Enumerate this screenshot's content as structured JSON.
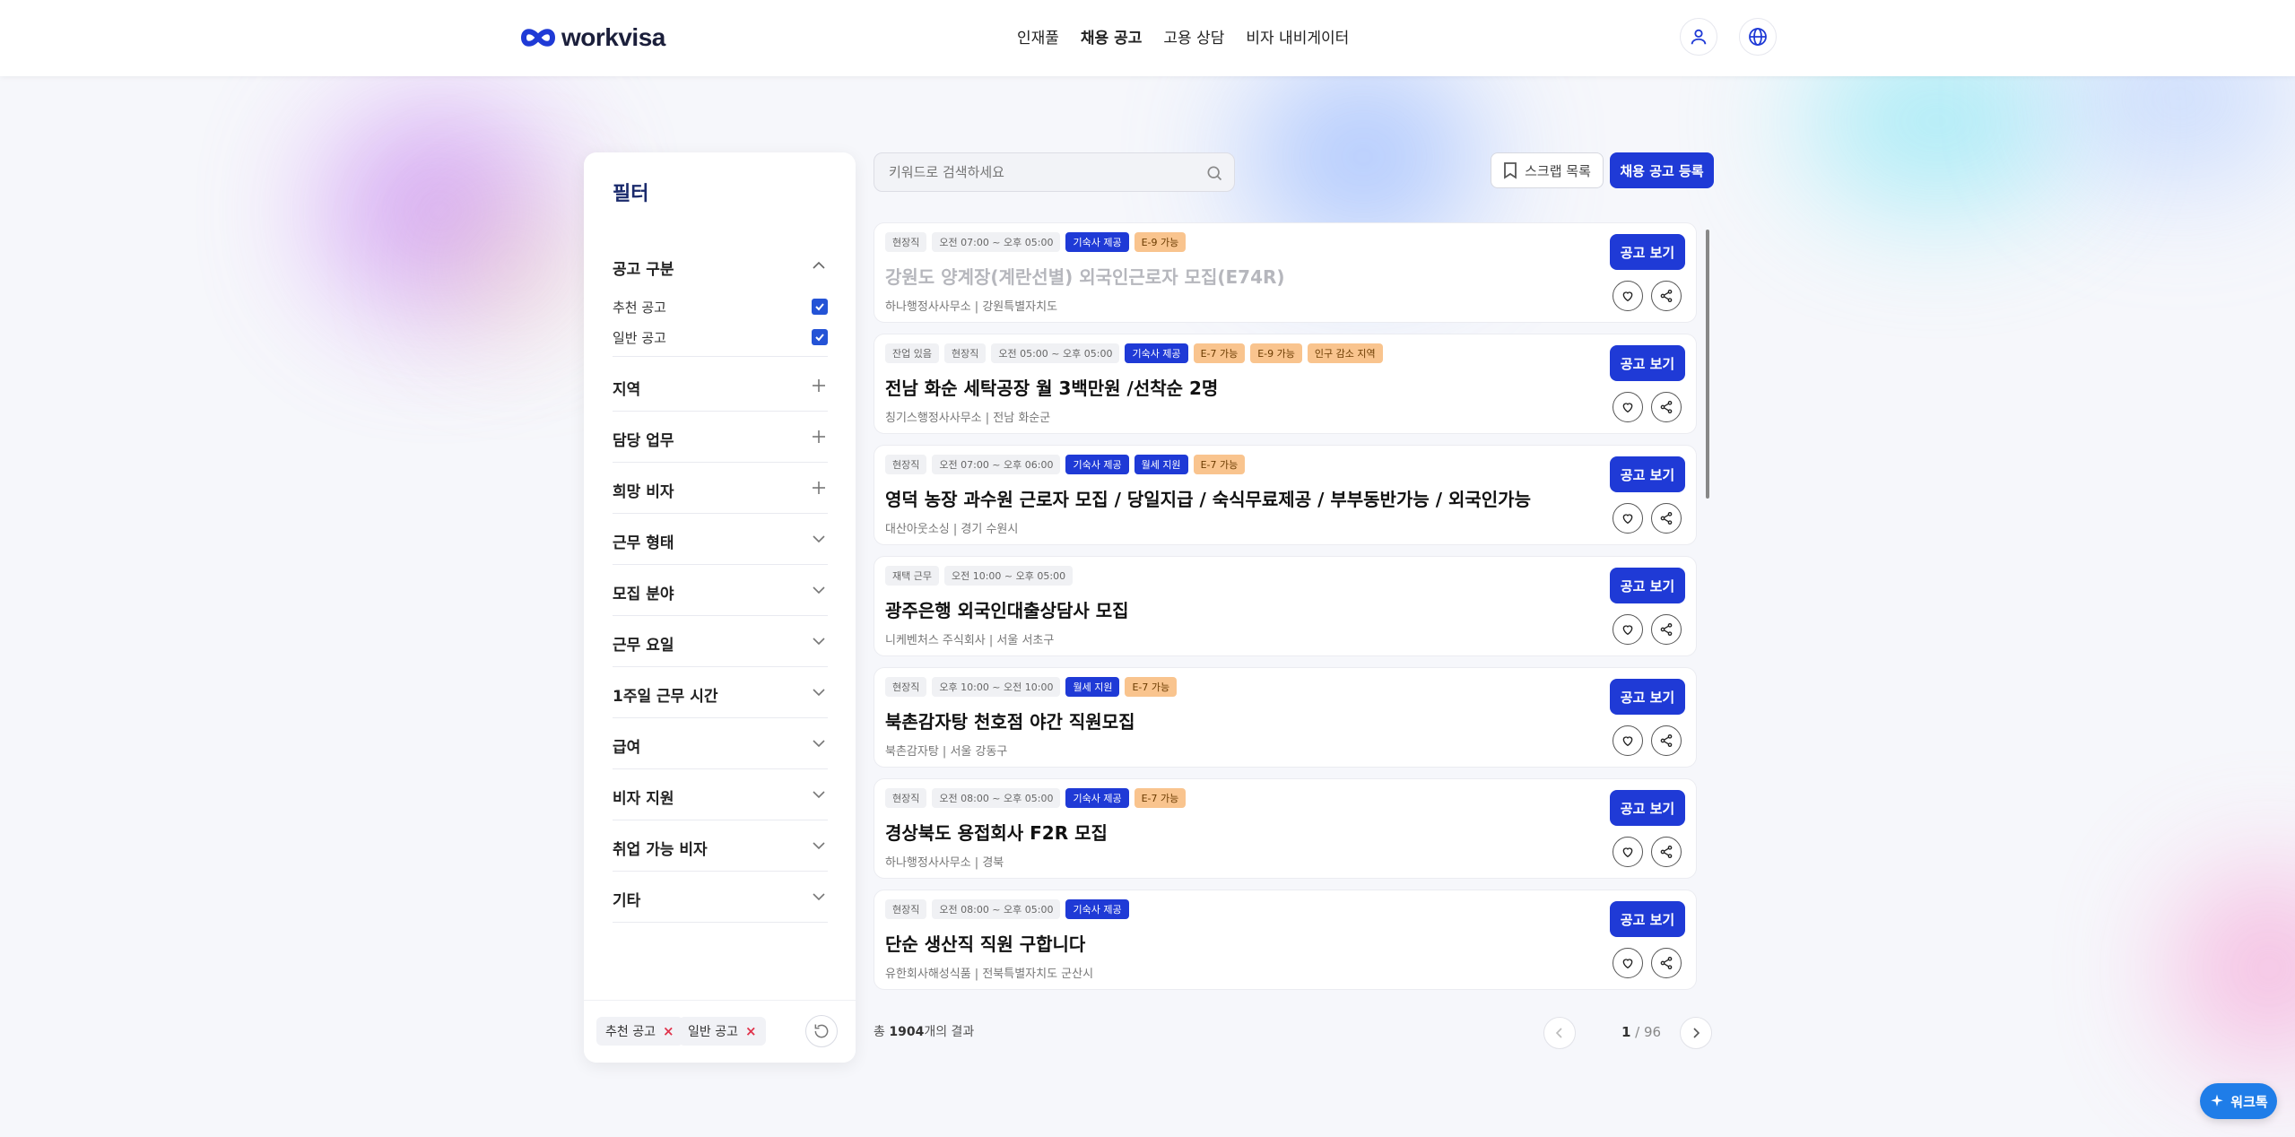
{
  "header": {
    "logo_text": "workvisa",
    "nav": [
      "인재풀",
      "채용 공고",
      "고용 상담",
      "비자 내비게이터"
    ],
    "active_nav": 1,
    "icons": [
      "user-icon",
      "globe-icon"
    ]
  },
  "sidebar": {
    "title": "필터",
    "notice_type": {
      "label": "공고 구분",
      "options": [
        {
          "label": "추천 공고",
          "checked": true
        },
        {
          "label": "일반 공고",
          "checked": true
        }
      ]
    },
    "sections": [
      {
        "label": "지역",
        "control": "plus"
      },
      {
        "label": "담당 업무",
        "control": "plus"
      },
      {
        "label": "희망 비자",
        "control": "plus"
      },
      {
        "label": "근무 형태",
        "control": "chevron"
      },
      {
        "label": "모집 분야",
        "control": "chevron"
      },
      {
        "label": "근무 요일",
        "control": "chevron"
      },
      {
        "label": "1주일 근무 시간",
        "control": "chevron"
      },
      {
        "label": "급여",
        "control": "chevron"
      },
      {
        "label": "비자 지원",
        "control": "chevron"
      },
      {
        "label": "취업 가능 비자",
        "control": "chevron"
      },
      {
        "label": "기타",
        "control": "chevron"
      }
    ],
    "chips": [
      "추천 공고",
      "일반 공고"
    ],
    "chip_remove": "×"
  },
  "search": {
    "placeholder": "키워드로 검색하세요",
    "value": ""
  },
  "toolbar": {
    "scrap_label": "스크랩 목록",
    "post_label": "채용 공고 등록"
  },
  "jobs": [
    {
      "tags": [
        {
          "t": "현장직",
          "s": "gray"
        },
        {
          "t": "오전 07:00 ~ 오후 05:00",
          "s": "gray"
        },
        {
          "t": "기숙사 제공",
          "s": "blue"
        },
        {
          "t": "E-9 가능",
          "s": "orange"
        }
      ],
      "title": "강원도 양계장(계란선별) 외국인근로자 모집(E74R)",
      "dim": true,
      "meta": "하나행정사사무소 | 강원특별자치도"
    },
    {
      "tags": [
        {
          "t": "잔업 있음",
          "s": "gray"
        },
        {
          "t": "현장직",
          "s": "gray"
        },
        {
          "t": "오전 05:00 ~ 오후 05:00",
          "s": "gray"
        },
        {
          "t": "기숙사 제공",
          "s": "blue"
        },
        {
          "t": "E-7 가능",
          "s": "orange"
        },
        {
          "t": "E-9 가능",
          "s": "orange"
        },
        {
          "t": "인구 감소 지역",
          "s": "orange"
        }
      ],
      "title": "전남 화순 세탁공장 월 3백만원 /선착순 2명",
      "dim": false,
      "meta": "칭기스행정사사무소 | 전남 화순군"
    },
    {
      "tags": [
        {
          "t": "현장직",
          "s": "gray"
        },
        {
          "t": "오전 07:00 ~ 오후 06:00",
          "s": "gray"
        },
        {
          "t": "기숙사 제공",
          "s": "blue"
        },
        {
          "t": "월세 지원",
          "s": "blue"
        },
        {
          "t": "E-7 가능",
          "s": "orange"
        }
      ],
      "title": "영덕 농장 과수원 근로자 모집 / 당일지급 / 숙식무료제공 / 부부동반가능 / 외국인가능",
      "dim": false,
      "meta": "대산아웃소싱 | 경기 수원시"
    },
    {
      "tags": [
        {
          "t": "재택 근무",
          "s": "gray"
        },
        {
          "t": "오전 10:00 ~ 오후 05:00",
          "s": "gray"
        }
      ],
      "title": "광주은행 외국인대출상담사 모집",
      "dim": false,
      "meta": "니케벤처스 주식회사 | 서울 서초구"
    },
    {
      "tags": [
        {
          "t": "현장직",
          "s": "gray"
        },
        {
          "t": "오후 10:00 ~ 오전 10:00",
          "s": "gray"
        },
        {
          "t": "월세 지원",
          "s": "blue"
        },
        {
          "t": "E-7 가능",
          "s": "orange"
        }
      ],
      "title": "북촌감자탕 천호점 야간 직원모집",
      "dim": false,
      "meta": "북촌감자탕 | 서울 강동구"
    },
    {
      "tags": [
        {
          "t": "현장직",
          "s": "gray"
        },
        {
          "t": "오전 08:00 ~ 오후 05:00",
          "s": "gray"
        },
        {
          "t": "기숙사 제공",
          "s": "blue"
        },
        {
          "t": "E-7 가능",
          "s": "orange"
        }
      ],
      "title": "경상북도 용접회사 F2R 모집",
      "dim": false,
      "meta": "하나행정사사무소 | 경북"
    },
    {
      "tags": [
        {
          "t": "현장직",
          "s": "gray"
        },
        {
          "t": "오전 08:00 ~ 오후 05:00",
          "s": "gray"
        },
        {
          "t": "기숙사 제공",
          "s": "blue"
        }
      ],
      "title": "단순 생산직 직원 구합니다",
      "dim": false,
      "meta": "유한회사해성식품 | 전북특별자치도 군산시"
    }
  ],
  "job_view_label": "공고 보기",
  "results": {
    "prefix": "총 ",
    "count": "1904",
    "suffix": "개의 결과"
  },
  "pagination": {
    "current": "1",
    "sep": " / ",
    "total": "96"
  },
  "float_button": {
    "label": "워크톡"
  },
  "colors": {
    "brand_blue": "#1f3ad6",
    "tag_orange": "#f9c48e",
    "checkbox_blue": "#2453d6"
  }
}
